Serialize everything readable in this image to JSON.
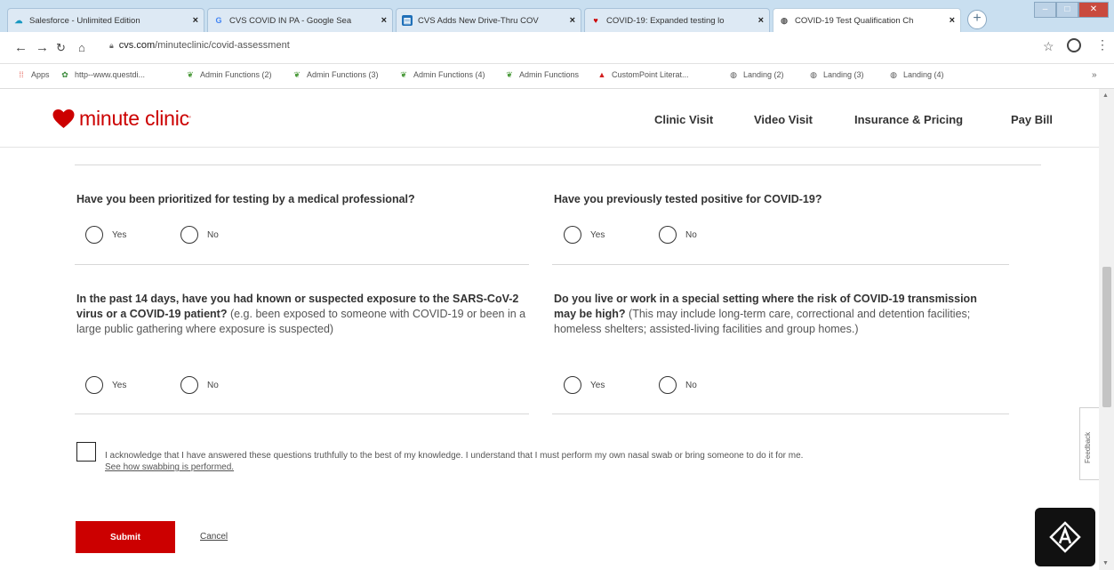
{
  "browser": {
    "tabs": [
      {
        "title": "Salesforce - Unlimited Edition",
        "icon": "salesforce-icon",
        "color": "#1798c1",
        "active": false
      },
      {
        "title": "CVS COVID IN PA - Google Sea",
        "icon": "google-icon",
        "color": "#4285f4",
        "active": false
      },
      {
        "title": "CVS Adds New Drive-Thru COV",
        "icon": "news-icon",
        "color": "#1e6fb8",
        "active": false
      },
      {
        "title": "COVID-19: Expanded testing lo",
        "icon": "cvs-heart-icon",
        "color": "#cc0000",
        "active": false
      },
      {
        "title": "COVID-19 Test Qualification Ch",
        "icon": "globe-icon",
        "color": "#555555",
        "active": true
      }
    ],
    "new_tab": "+",
    "url_host": "cvs.com",
    "url_path": "/minuteclinic/covid-assessment",
    "bookmarks": [
      {
        "label": "Apps",
        "icon": "apps-grid-icon",
        "color": "#e0463b"
      },
      {
        "label": "http--www.questdi...",
        "icon": "quest-icon",
        "color": "#3a8a3a"
      },
      {
        "label": "Admin Functions (2)",
        "icon": "leaf-icon",
        "color": "#4a9a3a"
      },
      {
        "label": "Admin Functions (3)",
        "icon": "leaf-icon",
        "color": "#4a9a3a"
      },
      {
        "label": "Admin Functions (4)",
        "icon": "leaf-icon",
        "color": "#4a9a3a"
      },
      {
        "label": "Admin Functions",
        "icon": "leaf-icon",
        "color": "#4a9a3a"
      },
      {
        "label": "CustomPoint Literat...",
        "icon": "triangle-icon",
        "color": "#d21f1f"
      },
      {
        "label": "Landing (2)",
        "icon": "globe-icon",
        "color": "#555555"
      },
      {
        "label": "Landing (3)",
        "icon": "globe-icon",
        "color": "#555555"
      },
      {
        "label": "Landing (4)",
        "icon": "globe-icon",
        "color": "#555555"
      }
    ],
    "bookmarks_more": "»"
  },
  "header": {
    "logo_text": "minute clinic",
    "logo_mark": "'",
    "brand_color": "#cc0000",
    "nav": [
      "Clinic Visit",
      "Video Visit",
      "Insurance & Pricing",
      "Pay Bill"
    ]
  },
  "questions": [
    {
      "bold": "Have you been prioritized for testing by a medical professional?",
      "sub": "",
      "yes": "Yes",
      "no": "No"
    },
    {
      "bold": "Have you previously tested positive for COVID-19?",
      "sub": "",
      "yes": "Yes",
      "no": "No"
    },
    {
      "bold": "In the past 14 days, have you had known or suspected exposure to the SARS-CoV-2 virus or a COVID-19 patient?",
      "sub": " (e.g. been exposed to someone with COVID-19 or been in a large public gathering where exposure is suspected)",
      "yes": "Yes",
      "no": "No"
    },
    {
      "bold": "Do you live or work in a special setting where the risk of COVID-19 transmission may be high?",
      "sub": " (This may include long-term care, correctional and detention facilities; homeless shelters; assisted-living facilities and group homes.)",
      "yes": "Yes",
      "no": "No"
    }
  ],
  "acknowledge": {
    "text": "I acknowledge that I have answered these questions truthfully to the best of my knowledge. I understand that I must perform my own nasal swab or bring someone to do it for me.",
    "link": "See how swabbing is performed."
  },
  "actions": {
    "submit": "Submit",
    "cancel": "Cancel"
  },
  "feedback_tab": "Feedback"
}
